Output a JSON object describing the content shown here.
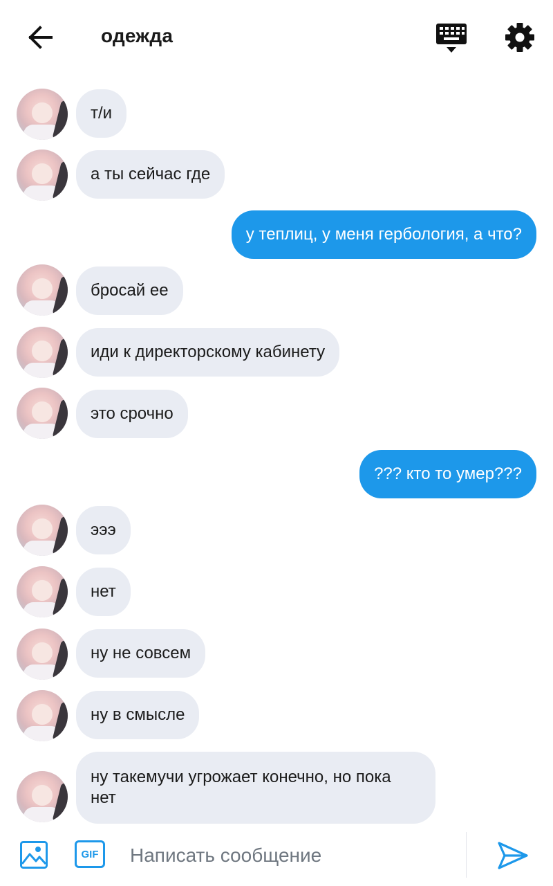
{
  "header": {
    "title": "одежда",
    "back_icon": "arrow-left-icon",
    "keyboard_icon": "keyboard-icon",
    "settings_icon": "gear-icon"
  },
  "messages": [
    {
      "side": "in",
      "text": "т/и"
    },
    {
      "side": "in",
      "text": "а ты сейчас где"
    },
    {
      "side": "out",
      "text": "у теплиц, у меня гербология, а что?"
    },
    {
      "side": "in",
      "text": "бросай ее"
    },
    {
      "side": "in",
      "text": "иди к директорскому кабинету"
    },
    {
      "side": "in",
      "text": "это срочно"
    },
    {
      "side": "out",
      "text": "??? кто то умер???"
    },
    {
      "side": "in",
      "text": "эээ"
    },
    {
      "side": "in",
      "text": "нет"
    },
    {
      "side": "in",
      "text": "ну не совсем"
    },
    {
      "side": "in",
      "text": "ну в смысле"
    },
    {
      "side": "in",
      "text": "ну такемучи угрожает конечно, но пока нет"
    }
  ],
  "composer": {
    "placeholder": "Написать сообщение",
    "gif_label": "GIF",
    "image_icon": "image-icon",
    "send_icon": "send-icon"
  },
  "colors": {
    "accent": "#1d98ea",
    "incoming_bubble": "#e9ecf3",
    "outgoing_text": "#ffffff"
  }
}
